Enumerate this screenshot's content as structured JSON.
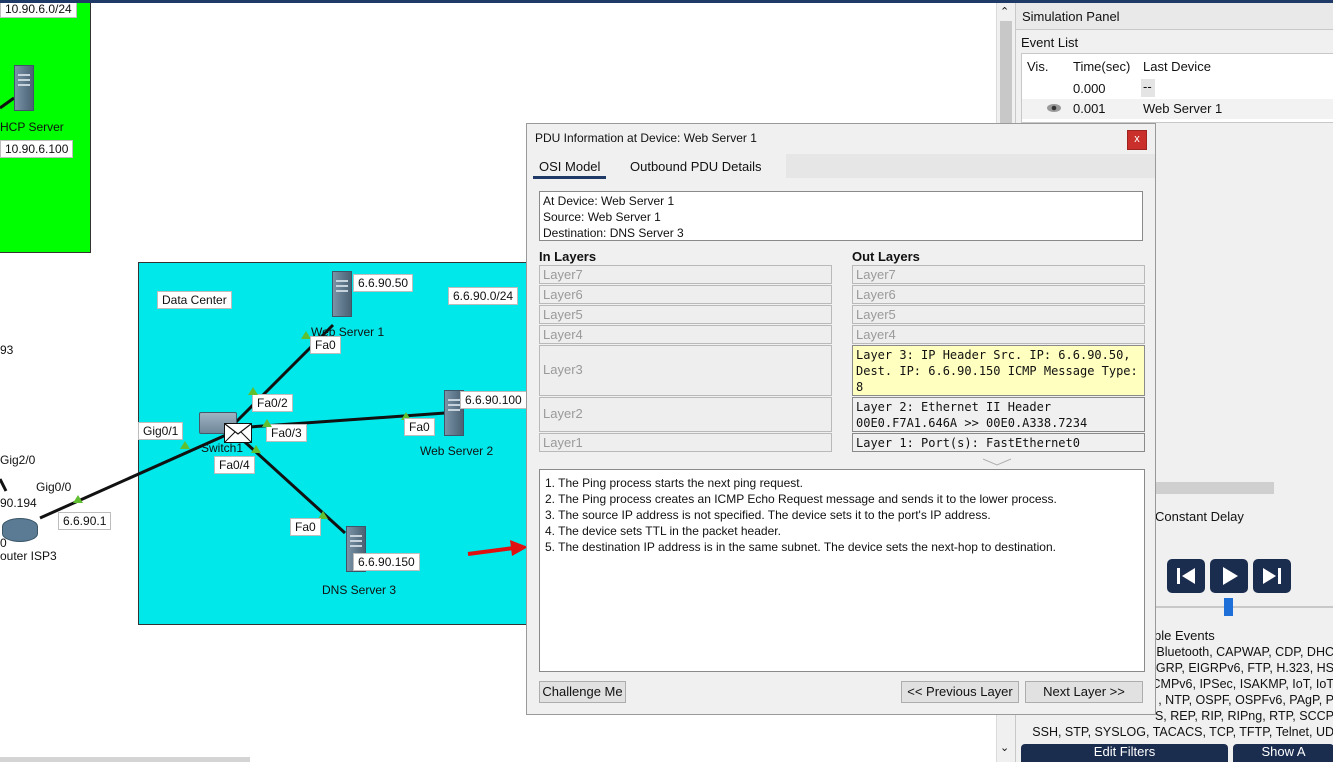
{
  "canvas": {
    "network_label_top": "10.90.6.0/24",
    "dhcp_server_label": "HCP Server",
    "dhcp_server_ip": "10.90.6.100",
    "left_partial_93": "93",
    "gig2_0": "Gig2/0",
    "left_ip_194": "90.194",
    "left_zero": "0",
    "router_label": "outer ISP3",
    "router_gig0_0": "Gig0/0",
    "router_ip": "6.6.90.1",
    "data_center_label": "Data Center",
    "subnet_label": "6.6.90.0/24",
    "web1_ip": "6.6.90.50",
    "web1_label": "Web Server 1",
    "web1_port": "Fa0",
    "web2_ip": "6.6.90.100",
    "web2_label": "Web Server 2",
    "web2_port": "Fa0",
    "dns3_ip": "6.6.90.150",
    "dns3_label": "DNS Server 3",
    "dns3_port": "Fa0",
    "switch_label": "Switch1",
    "switch_gig0_1": "Gig0/1",
    "switch_fa0_2": "Fa0/2",
    "switch_fa0_3": "Fa0/3",
    "switch_fa0_4": "Fa0/4"
  },
  "sim_panel": {
    "title": "Simulation Panel",
    "event_list": "Event List",
    "col_vis": "Vis.",
    "col_time": "Time(sec)",
    "col_last_device": "Last Device",
    "events": [
      {
        "time": "0.000",
        "device": "--"
      },
      {
        "time": "0.001",
        "device": "Web Server 1"
      }
    ],
    "constant_delay": "Constant Delay",
    "visible_events_partial": "ble Events",
    "filters_lines": [
      "Bluetooth, CAPWAP, CDP, DHC",
      "GRP, EIGRPv6, FTP, H.323, HS",
      "CMPv6, IPSec, ISAKMP, IoT, IoT",
      ", NTP, OSPF, OSPFv6, PAgP, P",
      "S, REP, RIP, RIPng, RTP, SCCP",
      "SSH, STP, SYSLOG, TACACS, TCP, TFTP, Telnet, UD"
    ],
    "edit_filters": "Edit Filters",
    "show_all": "Show A"
  },
  "pdu": {
    "title": "PDU Information at Device: Web Server 1",
    "close": "x",
    "tab_osi": "OSI Model",
    "tab_outbound": "Outbound PDU Details",
    "info_line1": "At Device: Web Server 1",
    "info_line2": "Source: Web Server 1",
    "info_line3": "Destination: DNS Server 3",
    "in_layers": "In Layers",
    "out_layers": "Out Layers",
    "in": [
      "Layer7",
      "Layer6",
      "Layer5",
      "Layer4",
      "Layer3",
      "Layer2",
      "Layer1"
    ],
    "out": {
      "l7": "Layer7",
      "l6": "Layer6",
      "l5": "Layer5",
      "l4": "Layer4",
      "l3": "Layer 3: IP Header Src. IP: 6.6.90.50, Dest. IP: 6.6.90.150 ICMP Message Type: 8",
      "l2": "Layer 2: Ethernet II Header 00E0.F7A1.646A >> 00E0.A338.7234",
      "l1": "Layer 1: Port(s): FastEthernet0"
    },
    "steps": [
      "1. The Ping process starts the next ping request.",
      "2. The Ping process creates an ICMP Echo Request message and sends it to the lower process.",
      "3. The source IP address is not specified. The device sets it to the port's IP address.",
      "4. The device sets TTL in the packet header.",
      "5. The destination IP address is in the same subnet. The device sets the next-hop to destination."
    ],
    "challenge": "Challenge Me",
    "prev": "<< Previous Layer",
    "next": "Next Layer >>"
  }
}
